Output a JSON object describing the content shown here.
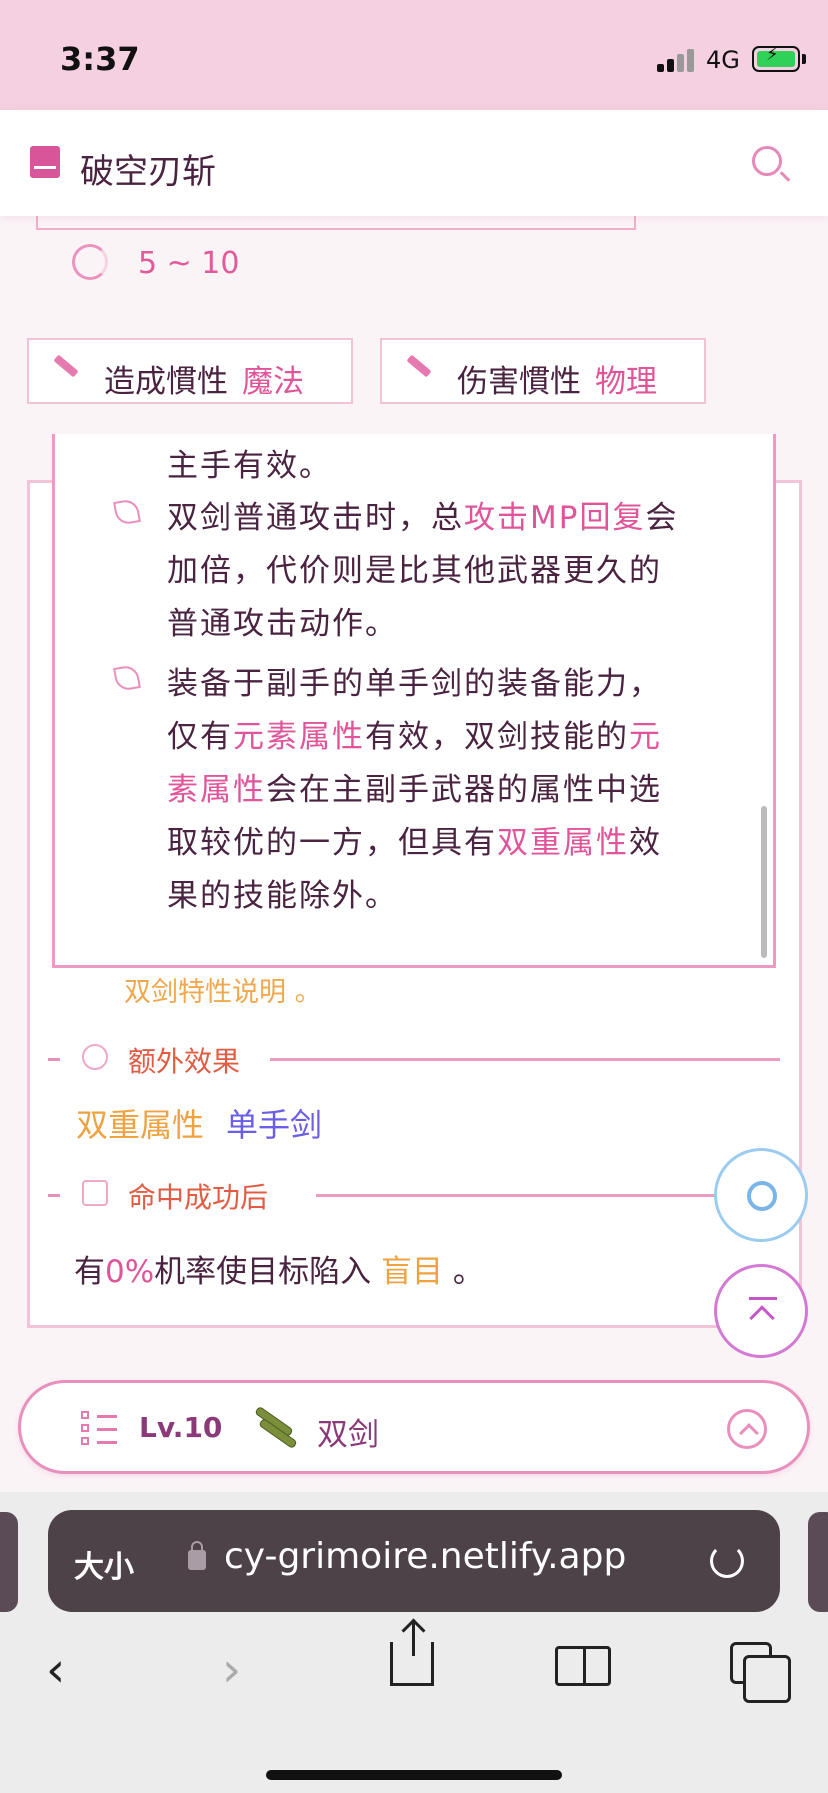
{
  "status_bar": {
    "time": "3:37",
    "network": "4G"
  },
  "header": {
    "title": "破空刃斩"
  },
  "skill": {
    "range": "5 ~ 10",
    "tags": [
      {
        "key": "造成慣性",
        "value": "魔法"
      },
      {
        "key": "伤害慣性",
        "value": "物理"
      }
    ]
  },
  "popup": {
    "line1": "主手有效。",
    "p1": {
      "a": "双剑普通攻击时，总",
      "b": "攻击MP回复",
      "c": "会",
      "line2": "加倍，代价则是比其他武器更久的",
      "line3": "普通攻击动作。"
    },
    "p2": {
      "line1": "装备于副手的单手剑的装备能力，",
      "l2a": "仅有",
      "l2b": "元素属性",
      "l2c": "有效，双剑技能的",
      "l2d": "元",
      "l3a": "素属性",
      "l3b": "会在主副手武器的属性中选",
      "l4a": "取较优的一方，但具有",
      "l4b": "双重属性",
      "l4c": "效",
      "line5": "果的技能除外。"
    }
  },
  "card": {
    "note": "双剑特性说明 。",
    "extra_title": "额外效果",
    "chip_a": "双重属性",
    "chip_b": "单手剑",
    "hit_title": "命中成功后",
    "effect": {
      "pre": "有",
      "pct": "0%",
      "mid": "机率使目标陷入 ",
      "status": "盲目",
      "post": " 。"
    }
  },
  "bottom_bar": {
    "level": "Lv.10",
    "weapon": "双剑"
  },
  "browser": {
    "text_size": "大小",
    "url": "cy-grimoire.netlify.app"
  },
  "colors": {
    "accent": "#e0559a",
    "orange": "#eea240",
    "purple": "#6a5de6"
  }
}
